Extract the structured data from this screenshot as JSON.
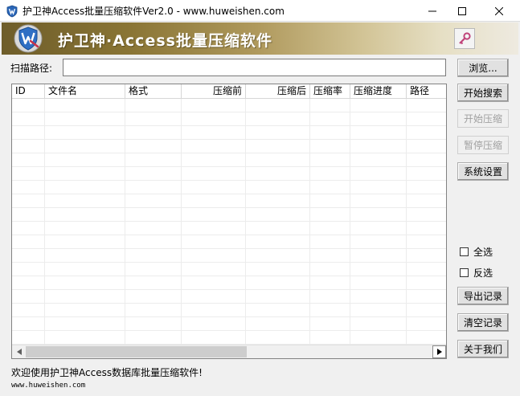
{
  "window": {
    "title": "护卫神Access批量压缩软件Ver2.0 - www.huweishen.com",
    "minimize_glyph": "—",
    "maximize_glyph": "☐",
    "close_glyph": "✕"
  },
  "banner": {
    "title": "护卫神·Access批量压缩软件",
    "key_icon": "key-icon"
  },
  "scan": {
    "label": "扫描路径:",
    "value": ""
  },
  "table": {
    "columns": [
      "ID",
      "文件名",
      "格式",
      "压缩前",
      "压缩后",
      "压缩率",
      "压缩进度",
      "路径"
    ],
    "rows": []
  },
  "buttons": {
    "browse": "浏览...",
    "start_search": "开始搜索",
    "start_compress": "开始压缩",
    "pause_compress": "暂停压缩",
    "settings": "系统设置",
    "export_log": "导出记录",
    "clear_log": "清空记录",
    "about": "关于我们"
  },
  "checkboxes": {
    "select_all": "全选",
    "invert": "反选"
  },
  "status": {
    "welcome": "欢迎使用护卫神Access数据库批量压缩软件!",
    "website": "www.huweishen.com"
  },
  "colors": {
    "banner_dark": "#6e5d2a",
    "banner_light": "#eeeae0"
  }
}
